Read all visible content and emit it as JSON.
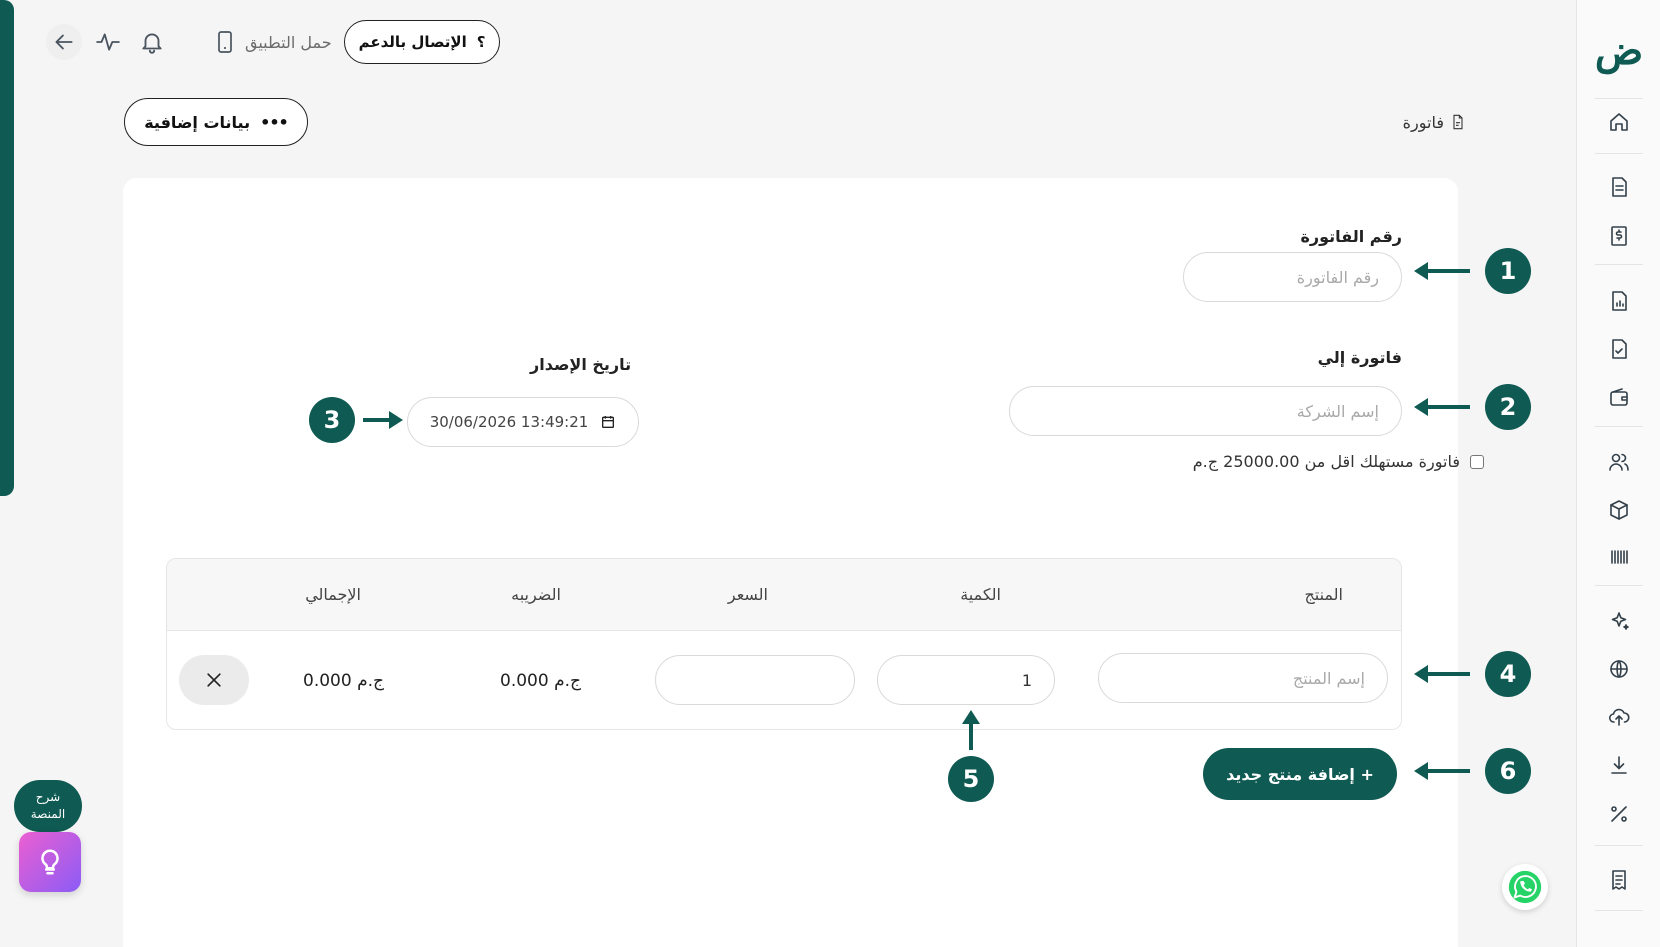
{
  "topbar": {
    "support_label": "الإتصال بالدعم",
    "support_glyph": "؟",
    "app_label": "حمل التطبيق"
  },
  "header": {
    "extra_data_label": "بيانات إضافية",
    "extra_data_glyph": "•••",
    "breadcrumb": "فاتورة"
  },
  "form": {
    "invoice_number_label": "رقم الفاتورة",
    "invoice_number_placeholder": "رقم الفاتورة",
    "invoice_to_label": "فاتورة إلي",
    "company_placeholder": "إسم الشركة",
    "issue_date_label": "تاريخ الإصدار",
    "issue_date_value": "30/06/2026 13:49:21",
    "consumer_checkbox_label": "فاتورة مستهلك اقل من 25000.00 ج.م"
  },
  "table": {
    "headers": {
      "product": "المنتج",
      "quantity": "الكمية",
      "price": "السعر",
      "tax": "الضريبه",
      "total": "الإجمالي"
    },
    "row": {
      "product_placeholder": "إسم المنتج",
      "quantity": "1",
      "price": "",
      "tax": "0.000 ج.م",
      "total": "0.000 ج.م"
    }
  },
  "add_product_label": "+ إضافة منتج جديد",
  "annotations": [
    "1",
    "2",
    "3",
    "4",
    "5",
    "6"
  ],
  "help": {
    "line1": "شرح",
    "line2": "المنصة"
  },
  "sidebar": {
    "logo_text": "ض",
    "icons": [
      "home-icon",
      "document-icon",
      "invoice-dollar-icon",
      "report-chart-icon",
      "file-check-icon",
      "wallet-icon",
      "users-icon",
      "box-icon",
      "barcode-icon",
      "sparkles-icon",
      "globe-icon",
      "cloud-upload-icon",
      "download-icon",
      "percent-icon",
      "receipt-icon"
    ]
  },
  "colors": {
    "brand": "#0f5a52",
    "background": "#f5f5f5",
    "card": "#ffffff",
    "help_gradient_start": "#ec5fd1",
    "help_gradient_end": "#8b5cf6",
    "whatsapp": "#25d366"
  }
}
